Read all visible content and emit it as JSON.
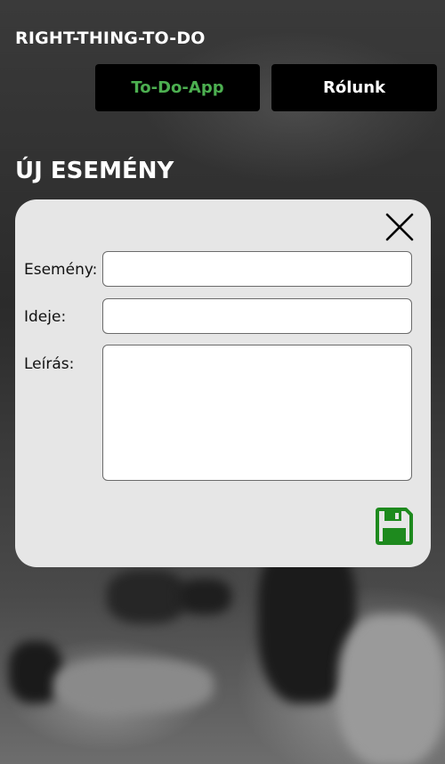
{
  "header": {
    "app_title": "RIGHT-THING-TO-DO"
  },
  "nav": {
    "todo_label": "To-Do-App",
    "about_label": "Rólunk",
    "active_color": "#4caf50"
  },
  "page": {
    "section_title": "ÚJ ESEMÉNY"
  },
  "form": {
    "event_label": "Esemény:",
    "event_value": "",
    "time_label": "Ideje:",
    "time_value": "",
    "description_label": "Leírás:",
    "description_value": "",
    "close_icon": "close-icon",
    "save_icon": "save-icon",
    "save_color": "#1e8a1e"
  }
}
